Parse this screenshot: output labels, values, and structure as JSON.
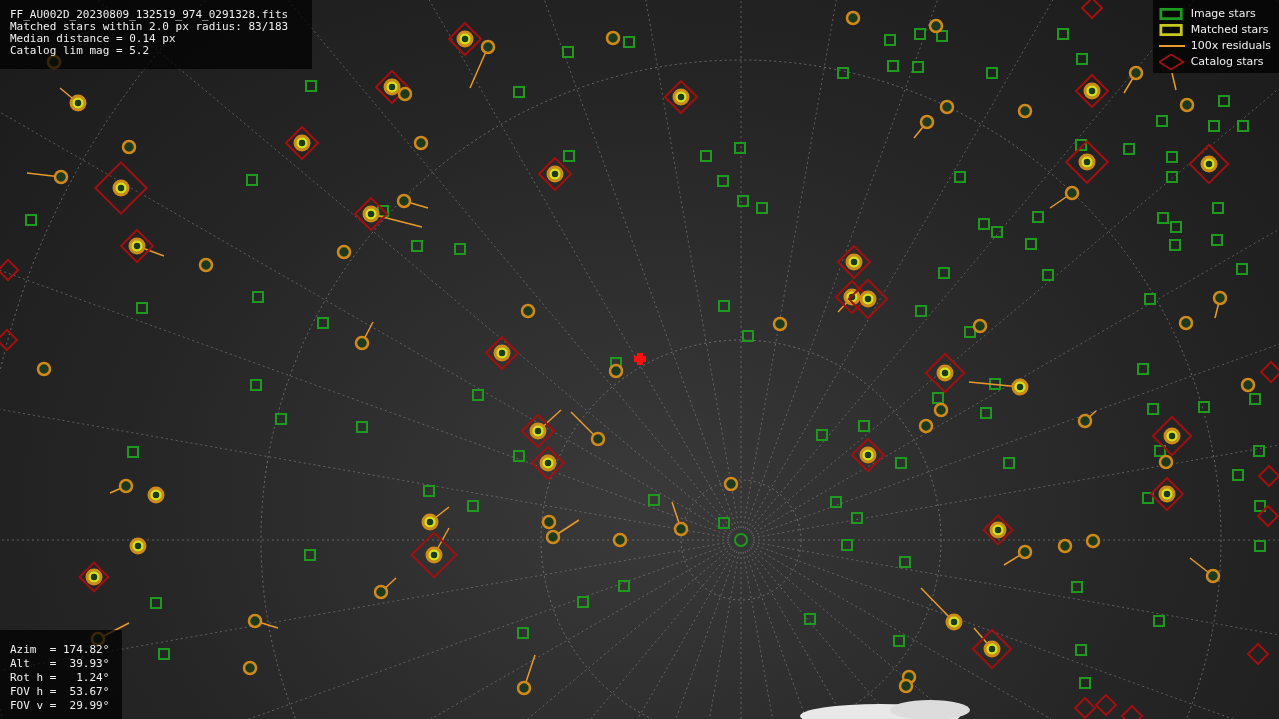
{
  "header": {
    "lines": [
      "FF_AU002D_20230809_132519_974_0291328.fits",
      "Matched stars within 2.0 px radius: 83/183",
      "Median distance = 0.14 px",
      "Catalog lim mag = 5.2"
    ]
  },
  "legend": {
    "items": [
      {
        "label": "Image stars",
        "kind": "box",
        "color": "#1e9a1e"
      },
      {
        "label": "Matched stars",
        "kind": "box",
        "color": "#c8c81e"
      },
      {
        "label": "100x residuals",
        "kind": "line",
        "color": "#e89a2a"
      },
      {
        "label": "Catalog stars",
        "kind": "diamond",
        "color": "#a01010"
      }
    ]
  },
  "pointing": {
    "lines": [
      "Azim  = 174.82°",
      "Alt   =  39.93°",
      "Rot h =   1.24°",
      "FOV h =  53.67°",
      "FOV v =  29.99°"
    ]
  }
}
